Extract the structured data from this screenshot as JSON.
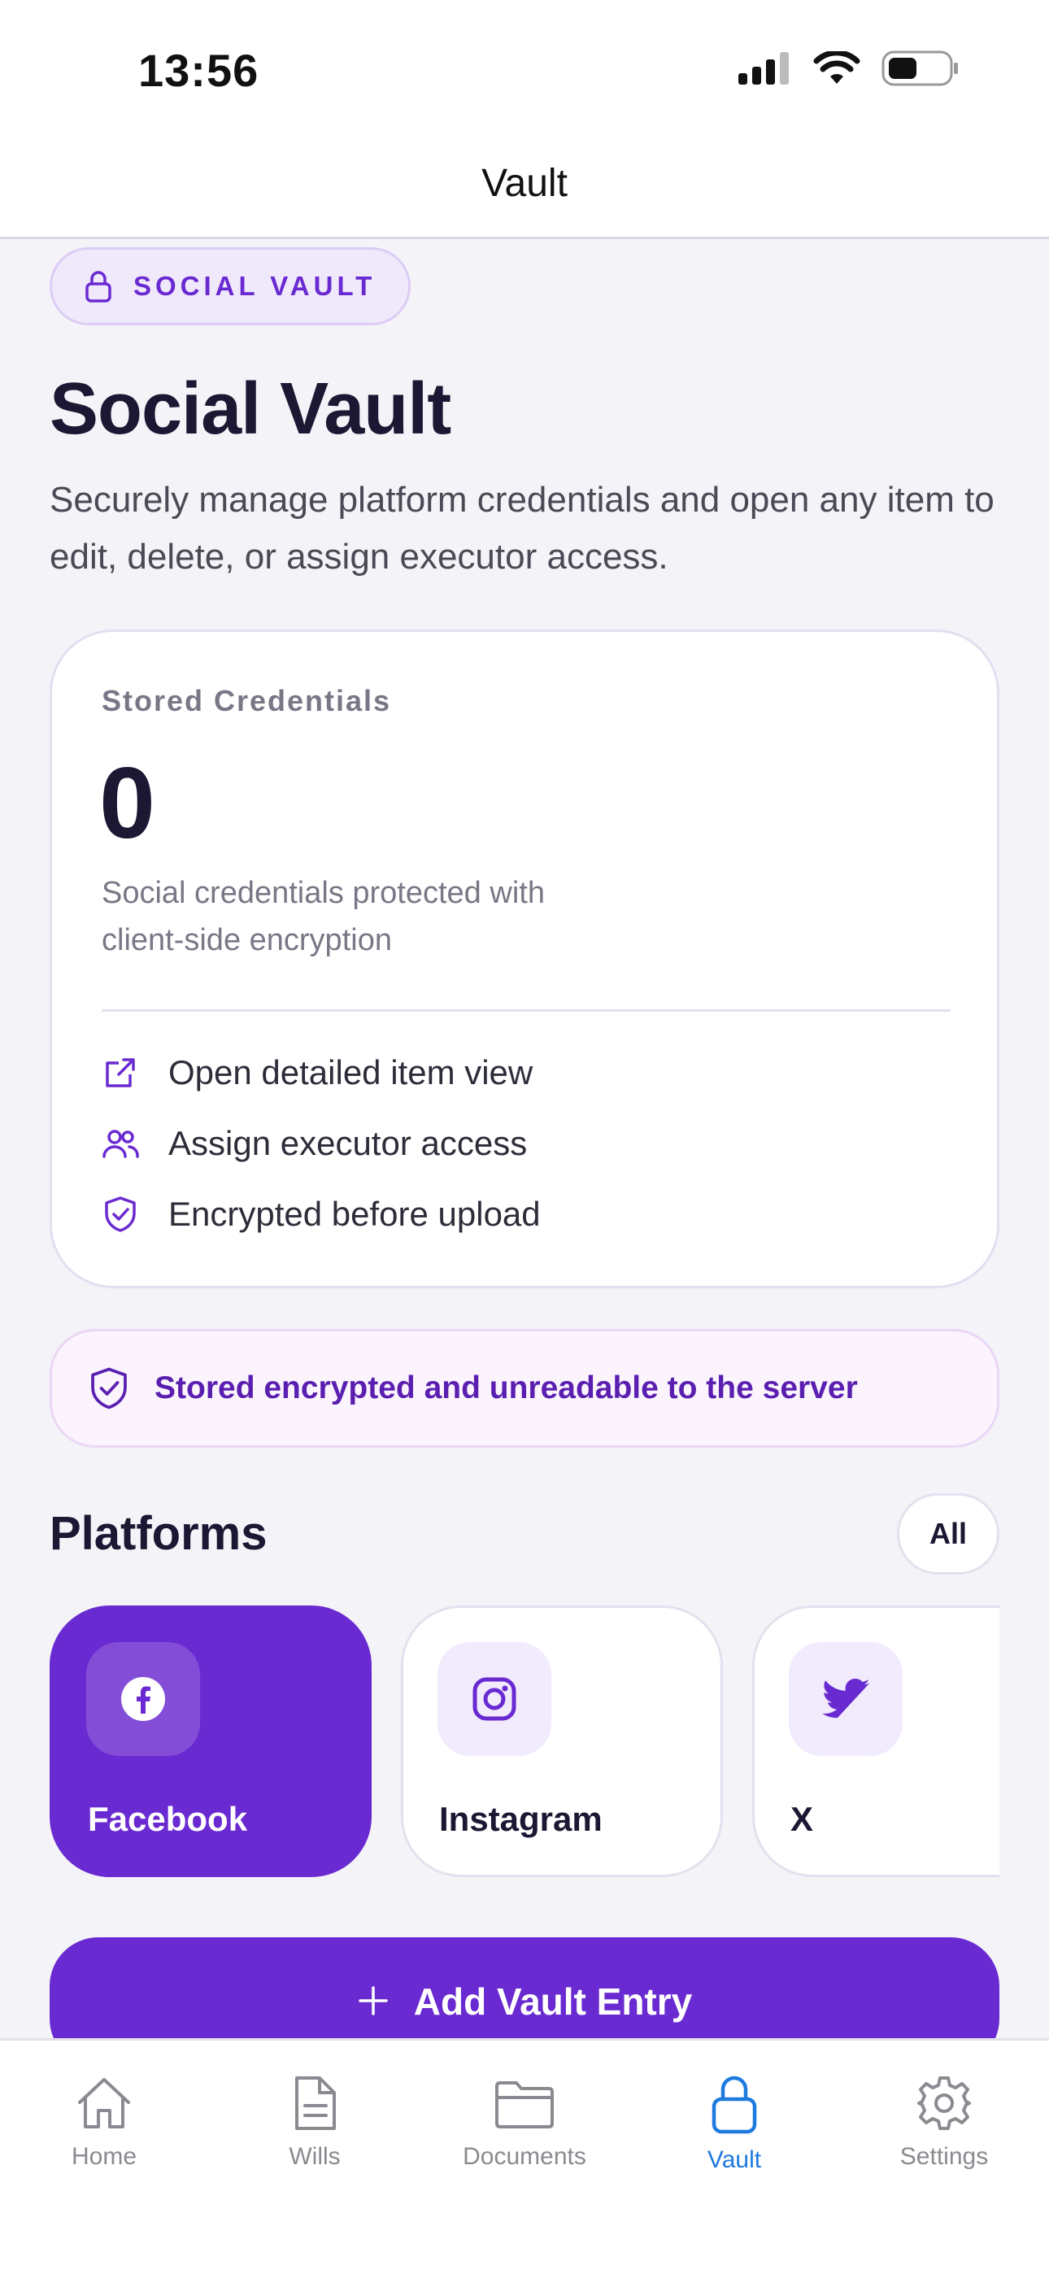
{
  "status_bar": {
    "time": "13:56"
  },
  "nav": {
    "title": "Vault"
  },
  "badge": {
    "label": "SOCIAL VAULT"
  },
  "page": {
    "title": "Social Vault",
    "description": "Securely manage platform credentials and open any item to edit, delete, or assign executor access."
  },
  "stats_card": {
    "kicker": "Stored Credentials",
    "count": "0",
    "subtitle": "Social credentials protected with client-side encryption",
    "features": [
      {
        "icon": "external-link-icon",
        "label": "Open detailed item view"
      },
      {
        "icon": "users-icon",
        "label": "Assign executor access"
      },
      {
        "icon": "shield-check-icon",
        "label": "Encrypted before upload"
      }
    ]
  },
  "notice": {
    "text": "Stored encrypted and unreadable to the server"
  },
  "platforms_section": {
    "title": "Platforms",
    "filter_label": "All",
    "items": [
      {
        "name": "Facebook",
        "icon": "facebook-icon",
        "selected": true
      },
      {
        "name": "Instagram",
        "icon": "instagram-icon",
        "selected": false
      },
      {
        "name": "X",
        "icon": "twitter-icon",
        "selected": false
      }
    ]
  },
  "add_button": {
    "label": "Add Vault Entry"
  },
  "tabbar": {
    "tabs": [
      {
        "label": "Home",
        "icon": "home-icon",
        "active": false
      },
      {
        "label": "Wills",
        "icon": "document-icon",
        "active": false
      },
      {
        "label": "Documents",
        "icon": "folder-icon",
        "active": false
      },
      {
        "label": "Vault",
        "icon": "lock-icon",
        "active": true
      },
      {
        "label": "Settings",
        "icon": "gear-icon",
        "active": false
      }
    ]
  },
  "colors": {
    "accent": "#6a2ad1",
    "tab_active": "#1f7ae0",
    "background": "#f4f3f8"
  }
}
